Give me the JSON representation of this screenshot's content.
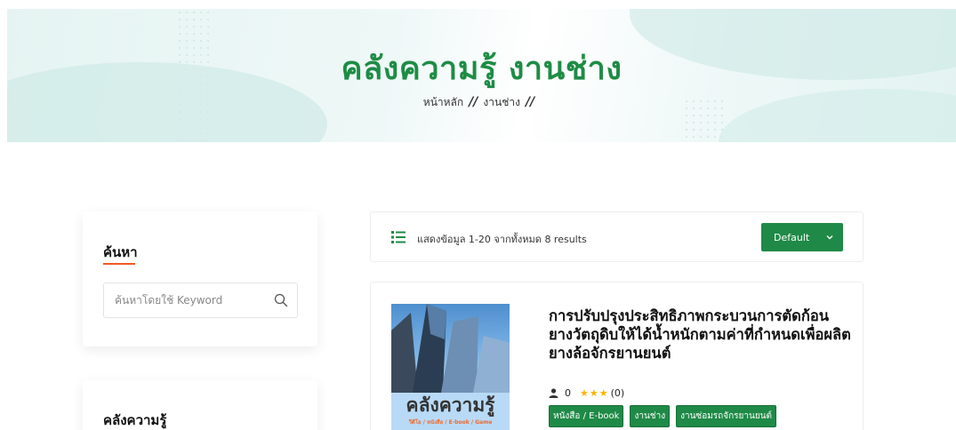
{
  "hero": {
    "title": "คลังความรู้ งานช่าง",
    "breadcrumb": [
      {
        "label": "หน้าหลัก"
      },
      {
        "label": "งานช่าง"
      }
    ],
    "separator": "//"
  },
  "sidebar": {
    "search": {
      "heading": "ค้นหา",
      "placeholder": "ค้นหาโดยใช้ Keyword"
    },
    "knowledge": {
      "heading": "คลังความรู้"
    }
  },
  "toolbar": {
    "result_text": "แสดงข้อมูล 1-20 จากทั้งหมด 8 results",
    "sort_label": "Default"
  },
  "products": [
    {
      "title": "การปรับปรุงประสิทธิภาพกระบวนการตัดก้อนยางวัตถุดิบให้ได้น้ำหนักตามค่าที่กำหนดเพื่อผลิตยางล้อจักรยานยนต์",
      "cover_title": "คลังความรู้",
      "cover_subtitle": "วีดีโอ / หนังสือ / E-book / Game",
      "author_count": "0",
      "stars": "★★★",
      "rating": "(0)",
      "tags": [
        "หนังสือ / E-book",
        "งานช่าง",
        "งานซ่อมรถจักรยานยนต์"
      ]
    }
  ],
  "colors": {
    "brand_green": "#1f8a47",
    "title_green": "#1e8c45",
    "accent_orange": "#ef5b25",
    "star": "#f7b500"
  }
}
